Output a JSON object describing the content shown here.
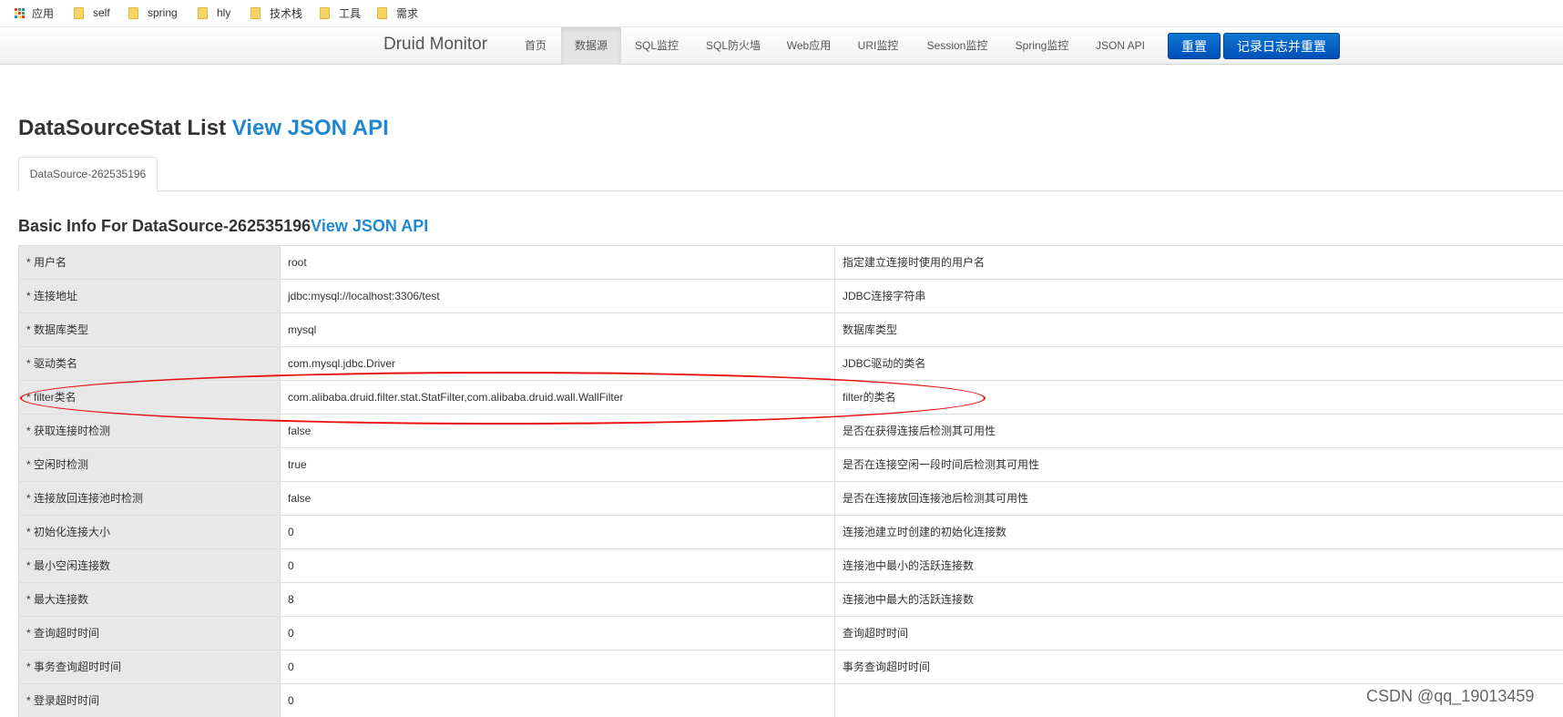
{
  "bookmarks": [
    {
      "label": "应用",
      "icon": "apps-grid-icon"
    },
    {
      "label": "self",
      "icon": "folder-icon"
    },
    {
      "label": "spring",
      "icon": "folder-icon"
    },
    {
      "label": "hly",
      "icon": "folder-icon"
    },
    {
      "label": "技术栈",
      "icon": "folder-icon"
    },
    {
      "label": "工具",
      "icon": "folder-icon"
    },
    {
      "label": "需求",
      "icon": "folder-icon"
    }
  ],
  "navbar": {
    "brand": "Druid Monitor",
    "items": [
      {
        "label": "首页",
        "active": false
      },
      {
        "label": "数据源",
        "active": true
      },
      {
        "label": "SQL监控",
        "active": false
      },
      {
        "label": "SQL防火墙",
        "active": false
      },
      {
        "label": "Web应用",
        "active": false
      },
      {
        "label": "URI监控",
        "active": false
      },
      {
        "label": "Session监控",
        "active": false
      },
      {
        "label": "Spring监控",
        "active": false
      },
      {
        "label": "JSON API",
        "active": false
      }
    ],
    "reset_label": "重置",
    "log_reset_label": "记录日志并重置"
  },
  "page": {
    "title": "DataSourceStat List ",
    "title_link": "View JSON API",
    "tab_label": "DataSource-262535196",
    "section_title": "Basic Info For DataSource-262535196",
    "section_link": "View JSON API"
  },
  "rows": [
    {
      "name": "* 用户名",
      "value": "root",
      "desc": "指定建立连接时使用的用户名"
    },
    {
      "name": "* 连接地址",
      "value": "jdbc:mysql://localhost:3306/test",
      "desc": "JDBC连接字符串"
    },
    {
      "name": "* 数据库类型",
      "value": "mysql",
      "desc": "数据库类型"
    },
    {
      "name": "* 驱动类名",
      "value": "com.mysql.jdbc.Driver",
      "desc": "JDBC驱动的类名"
    },
    {
      "name": "* filter类名",
      "value": "com.alibaba.druid.filter.stat.StatFilter,com.alibaba.druid.wall.WallFilter",
      "desc": "filter的类名"
    },
    {
      "name": "* 获取连接时检测",
      "value": "false",
      "desc": "是否在获得连接后检测其可用性"
    },
    {
      "name": "* 空闲时检测",
      "value": "true",
      "desc": "是否在连接空闲一段时间后检测其可用性"
    },
    {
      "name": "* 连接放回连接池时检测",
      "value": "false",
      "desc": "是否在连接放回连接池后检测其可用性"
    },
    {
      "name": "* 初始化连接大小",
      "value": "0",
      "desc": "连接池建立时创建的初始化连接数"
    },
    {
      "name": "* 最小空闲连接数",
      "value": "0",
      "desc": "连接池中最小的活跃连接数"
    },
    {
      "name": "* 最大连接数",
      "value": "8",
      "desc": "连接池中最大的活跃连接数"
    },
    {
      "name": "* 查询超时时间",
      "value": "0",
      "desc": "查询超时时间"
    },
    {
      "name": "* 事务查询超时时间",
      "value": "0",
      "desc": "事务查询超时时间"
    },
    {
      "name": "* 登录超时时间",
      "value": "0",
      "desc": ""
    }
  ],
  "watermark": "CSDN @qq_19013459",
  "colors": {
    "accent": "#1f88d0",
    "button": "#0a63c8",
    "annotation": "#e81010"
  }
}
